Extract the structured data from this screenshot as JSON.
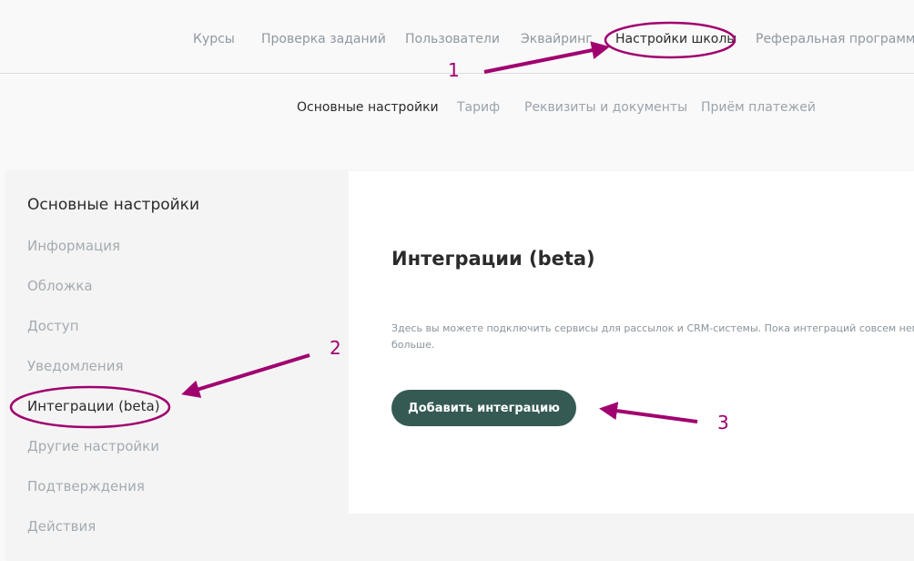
{
  "top_nav": {
    "courses": "Курсы",
    "checking": "Проверка заданий",
    "users": "Пользователи",
    "acquiring": "Эквайринг",
    "school_settings": "Настройки школы",
    "referral": "Реферальная программа"
  },
  "sub_nav": {
    "basic": "Основные настройки",
    "tariff": "Тариф",
    "requisites": "Реквизиты и документы",
    "payments": "Приём платежей"
  },
  "sidebar": {
    "title": "Основные настройки",
    "items": [
      {
        "label": "Информация"
      },
      {
        "label": "Обложка"
      },
      {
        "label": "Доступ"
      },
      {
        "label": "Уведомления"
      },
      {
        "label": "Интеграции (beta)"
      },
      {
        "label": "Другие настройки"
      },
      {
        "label": "Подтверждения"
      },
      {
        "label": "Действия"
      }
    ]
  },
  "content": {
    "title": "Интеграции (beta)",
    "description_line1": "Здесь вы можете подключить сервисы для рассылок и CRM-системы. Пока интеграций совсем немного, но скоро их будет",
    "description_line2": "больше.",
    "add_button": "Добавить интеграцию"
  },
  "annotations": {
    "color": "#a0006f",
    "marker_1": "1",
    "marker_2": "2",
    "marker_3": "3"
  }
}
